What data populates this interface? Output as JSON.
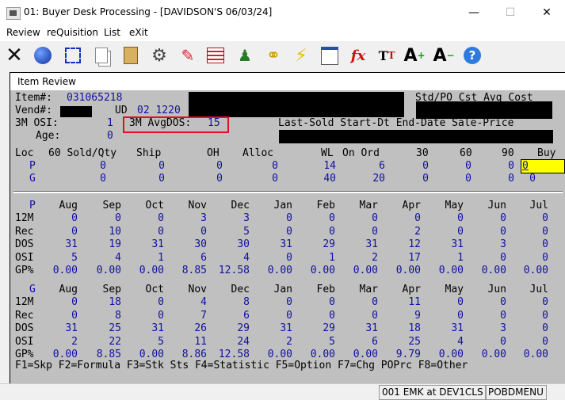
{
  "title": "01: Buyer Desk Processing - [DAVIDSON'S 06/03/24]",
  "menu": [
    "Review",
    "reQuisition",
    "List",
    "eXit"
  ],
  "toolbar_icons": [
    "exit-icon",
    "globe-icon",
    "select-icon",
    "copy-icon",
    "paste-icon",
    "settings-icon",
    "edit-icon",
    "table-icon",
    "users-icon",
    "link-icon",
    "lightning-icon",
    "chart-icon",
    "formula-icon",
    "font-icon",
    "increase-font-icon",
    "decrease-font-icon",
    "help-icon"
  ],
  "window_title": "Item Review",
  "header": {
    "item_label": "Item#:",
    "item_value": "031065218",
    "vend_label": "Vend#:",
    "ud_label": "UD",
    "ud_value": "02 1220",
    "osi_label": "3M OSI:",
    "osi_value": "1",
    "avgdos_label": "3M AvgDOS:",
    "avgdos_value": "15",
    "age_label": "Age:",
    "age_value": "0",
    "cost_header": "Std/PO Cst Avg Cost",
    "sale_header": "Last-Sold Start-Dt End-Date Sale-Price"
  },
  "loc_table": {
    "headers": [
      "Loc",
      "60 Sold/Qty",
      "Ship",
      "OH",
      "Alloc",
      "WL",
      "On Ord",
      "30",
      "60",
      "90",
      "Buy"
    ],
    "rows": [
      {
        "loc": "P",
        "sold": "0",
        "ship": "0",
        "oh": "0",
        "alloc": "0",
        "wl": "14",
        "onord": "6",
        "d30": "0",
        "d60": "0",
        "d90": "0",
        "buy": "0"
      },
      {
        "loc": "G",
        "sold": "0",
        "ship": "0",
        "oh": "0",
        "alloc": "0",
        "wl": "40",
        "onord": "20",
        "d30": "0",
        "d60": "0",
        "d90": "0",
        "buy": "0"
      }
    ]
  },
  "months": [
    "Aug",
    "Sep",
    "Oct",
    "Nov",
    "Dec",
    "Jan",
    "Feb",
    "Mar",
    "Apr",
    "May",
    "Jun",
    "Jul"
  ],
  "blocks": [
    {
      "loc": "P",
      "rows": [
        {
          "label": "12M",
          "values": [
            "0",
            "0",
            "0",
            "3",
            "3",
            "0",
            "0",
            "0",
            "0",
            "0",
            "0",
            "0"
          ]
        },
        {
          "label": "Rec",
          "values": [
            "0",
            "10",
            "0",
            "0",
            "5",
            "0",
            "0",
            "0",
            "2",
            "0",
            "0",
            "0"
          ]
        },
        {
          "label": "DOS",
          "values": [
            "31",
            "19",
            "31",
            "30",
            "30",
            "31",
            "29",
            "31",
            "12",
            "31",
            "3",
            "0"
          ]
        },
        {
          "label": "OSI",
          "values": [
            "5",
            "4",
            "1",
            "6",
            "4",
            "0",
            "1",
            "2",
            "17",
            "1",
            "0",
            "0"
          ]
        },
        {
          "label": "GP%",
          "values": [
            "0.00",
            "0.00",
            "0.00",
            "8.85",
            "12.58",
            "0.00",
            "0.00",
            "0.00",
            "0.00",
            "0.00",
            "0.00",
            "0.00"
          ]
        }
      ]
    },
    {
      "loc": "G",
      "rows": [
        {
          "label": "12M",
          "values": [
            "0",
            "18",
            "0",
            "4",
            "8",
            "0",
            "0",
            "0",
            "11",
            "0",
            "0",
            "0"
          ]
        },
        {
          "label": "Rec",
          "values": [
            "0",
            "8",
            "0",
            "7",
            "6",
            "0",
            "0",
            "0",
            "9",
            "0",
            "0",
            "0"
          ]
        },
        {
          "label": "DOS",
          "values": [
            "31",
            "25",
            "31",
            "26",
            "29",
            "31",
            "29",
            "31",
            "18",
            "31",
            "3",
            "0"
          ]
        },
        {
          "label": "OSI",
          "values": [
            "2",
            "22",
            "5",
            "11",
            "24",
            "2",
            "5",
            "6",
            "25",
            "4",
            "0",
            "0"
          ]
        },
        {
          "label": "GP%",
          "values": [
            "0.00",
            "8.85",
            "0.00",
            "8.86",
            "12.58",
            "0.00",
            "0.00",
            "0.00",
            "9.79",
            "0.00",
            "0.00",
            "0.00"
          ]
        }
      ]
    }
  ],
  "function_keys": "F1=Skp F2=Formula F3=Stk Sts F4=Statistic F5=Option F7=Chg POPrc F8=Other",
  "status": {
    "session": "001 EMK at DEV1CLS",
    "program": "POBDMENU"
  }
}
